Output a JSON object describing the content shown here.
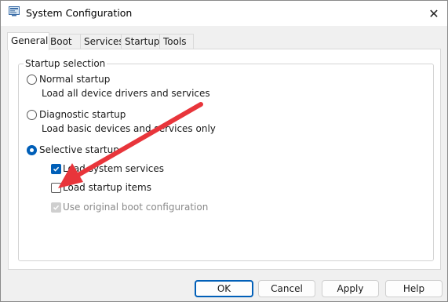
{
  "window": {
    "title": "System Configuration",
    "close_glyph": "✕"
  },
  "tabs": [
    {
      "label": "General",
      "active": true
    },
    {
      "label": "Boot",
      "active": false
    },
    {
      "label": "Services",
      "active": false
    },
    {
      "label": "Startup",
      "active": false
    },
    {
      "label": "Tools",
      "active": false
    }
  ],
  "startup_selection": {
    "group_label": "Startup selection",
    "normal": {
      "label": "Normal startup",
      "description": "Load all device drivers and services",
      "selected": false
    },
    "diagnostic": {
      "label": "Diagnostic startup",
      "description": "Load basic devices and services only",
      "selected": false
    },
    "selective": {
      "label": "Selective startup",
      "selected": true,
      "options": [
        {
          "label": "Load system services",
          "checked": true,
          "enabled": true
        },
        {
          "label": "Load startup items",
          "checked": false,
          "enabled": true
        },
        {
          "label": "Use original boot configuration",
          "checked": true,
          "enabled": false
        }
      ]
    }
  },
  "buttons": {
    "ok": "OK",
    "cancel": "Cancel",
    "apply": "Apply",
    "help": "Help"
  },
  "annotation": {
    "arrow_color": "#e8353b",
    "points_to": "Load startup items"
  },
  "colors": {
    "accent": "#005fb8"
  }
}
